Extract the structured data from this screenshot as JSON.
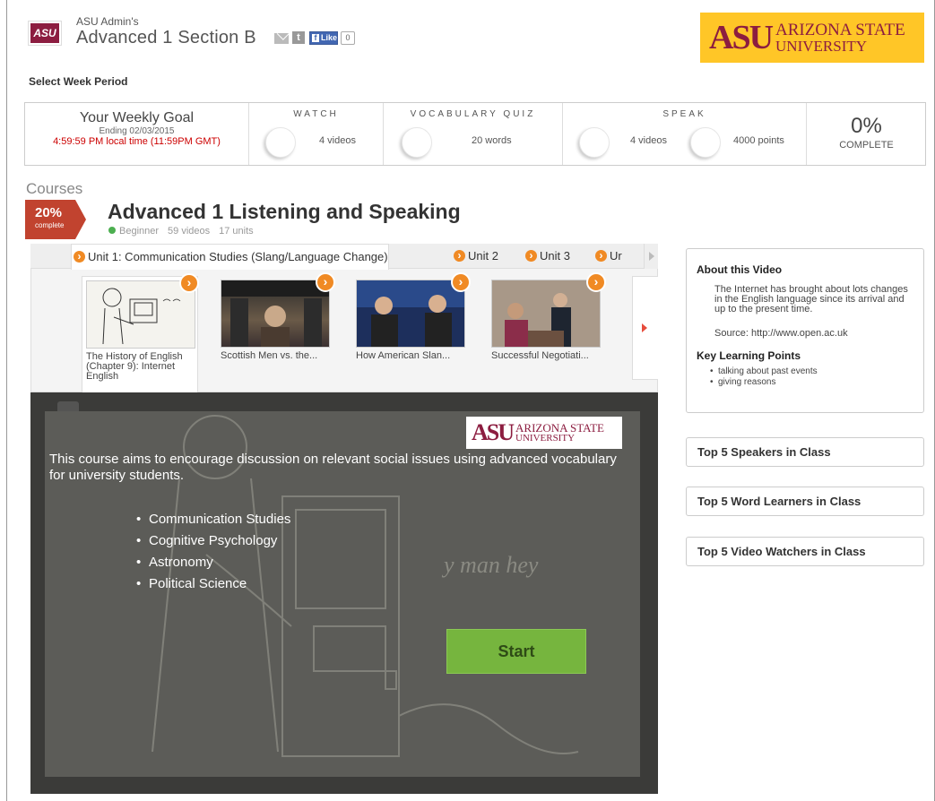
{
  "header": {
    "logo_text": "ASU",
    "owner": "ASU Admin's",
    "title": "Advanced 1 Section B",
    "fb_like": "Like",
    "fb_count": "0",
    "banner_mark": "ASU",
    "banner_line1": "ARIZONA STATE",
    "banner_line2": "UNIVERSITY",
    "banner_color": "#ffc627",
    "brand_color": "#8c1d40"
  },
  "week_label": "Select Week Period",
  "goal": {
    "title": "Your Weekly Goal",
    "ending": "Ending 02/03/2015",
    "deadline": "4:59:59 PM local time (11:59PM GMT)",
    "watch_head": "WATCH",
    "watch_val": "4 videos",
    "vocab_head": "VOCABULARY QUIZ",
    "vocab_val": "20 words",
    "speak_head": "SPEAK",
    "speak_val1": "4 videos",
    "speak_val2": "4000 points",
    "percent": "0%",
    "complete": "COMPLETE"
  },
  "course": {
    "section_label": "Courses",
    "progress": "20%",
    "progress_lbl": "complete",
    "progress_value": 20,
    "title": "Advanced 1 Listening and Speaking",
    "level": "Beginner",
    "videos": "59 videos",
    "units": "17 units"
  },
  "tabs": [
    {
      "label": "Unit 1: Communication Studies (Slang/Language Change)"
    },
    {
      "label": "Unit 2"
    },
    {
      "label": "Unit 3"
    },
    {
      "label": "Ur"
    }
  ],
  "videos": [
    {
      "caption": "The History of English (Chapter 9): Internet English"
    },
    {
      "caption": "Scottish Men vs. the..."
    },
    {
      "caption": "How American Slan..."
    },
    {
      "caption": "Successful Negotiati..."
    }
  ],
  "player": {
    "banner_mark": "ASU",
    "banner_line1": "ARIZONA STATE",
    "banner_line2": "UNIVERSITY",
    "description": "This course aims to encourage discussion on relevant social issues using advanced vocabulary for university students.",
    "topics": [
      "Communication Studies",
      "Cognitive Psychology",
      "Astronomy",
      "Political Science"
    ],
    "start_label": "Start",
    "start_color": "#76b53e",
    "sketch_text": "y man hey"
  },
  "about": {
    "title": "About this Video",
    "description": "The Internet has brought about lots changes in the English language since its arrival and up to the present time.",
    "source": "Source: http://www.open.ac.uk",
    "klp_title": "Key Learning Points",
    "points": [
      "talking about past events",
      "giving reasons"
    ]
  },
  "leaderboards": [
    {
      "label": "Top 5 Speakers in Class"
    },
    {
      "label": "Top 5 Word Learners in Class"
    },
    {
      "label": "Top 5 Video Watchers in Class"
    }
  ]
}
